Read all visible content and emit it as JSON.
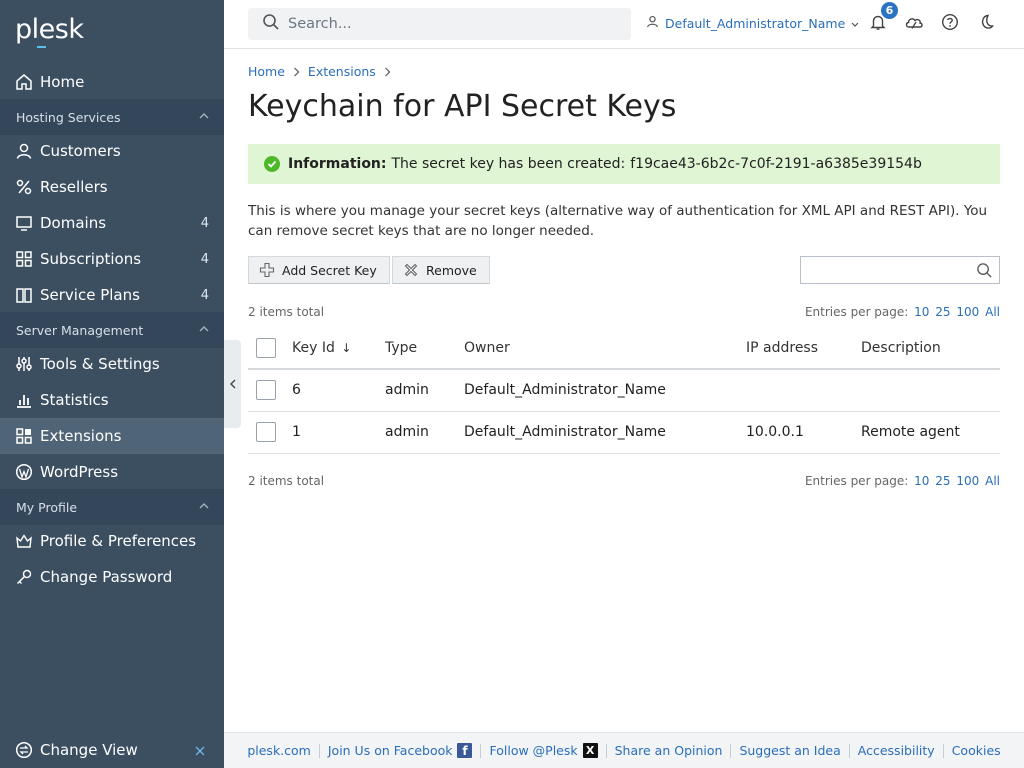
{
  "app": {
    "logo_text": "plesk"
  },
  "sidebar": {
    "home": "Home",
    "sections": {
      "hosting": "Hosting Services",
      "server": "Server Management",
      "profile": "My Profile"
    },
    "items": {
      "customers": "Customers",
      "resellers": "Resellers",
      "domains": {
        "label": "Domains",
        "count": "4"
      },
      "subscriptions": {
        "label": "Subscriptions",
        "count": "4"
      },
      "service_plans": {
        "label": "Service Plans",
        "count": "4"
      },
      "tools": "Tools & Settings",
      "statistics": "Statistics",
      "extensions": "Extensions",
      "wordpress": "WordPress",
      "profile_prefs": "Profile & Preferences",
      "change_password": "Change Password"
    },
    "change_view": "Change View"
  },
  "topbar": {
    "search_placeholder": "Search...",
    "user_name": "Default_Administrator_Name",
    "notification_count": "6"
  },
  "breadcrumb": [
    "Home",
    "Extensions"
  ],
  "page_title": "Keychain for API Secret Keys",
  "info": {
    "label": "Information:",
    "message": "The secret key has been created:",
    "key": "f19cae43-6b2c-7c0f-2191-a6385e39154b"
  },
  "description": "This is where you manage your secret keys (alternative way of authentication for XML API and REST API). You can remove secret keys that are no longer needed.",
  "toolbar": {
    "add_label": "Add Secret Key",
    "remove_label": "Remove"
  },
  "list": {
    "total_text": "2 items total",
    "entries_label": "Entries per page:",
    "page_sizes": [
      "10",
      "25",
      "100",
      "All"
    ],
    "columns": {
      "key_id": "Key Id",
      "sort_indicator": "↓",
      "type": "Type",
      "owner": "Owner",
      "ip": "IP address",
      "description": "Description"
    },
    "rows": [
      {
        "key_id": "6",
        "type": "admin",
        "owner": "Default_Administrator_Name",
        "ip": "",
        "description": ""
      },
      {
        "key_id": "1",
        "type": "admin",
        "owner": "Default_Administrator_Name",
        "ip": "10.0.0.1",
        "description": "Remote agent"
      }
    ]
  },
  "footer": {
    "links": [
      "plesk.com",
      "Join Us on Facebook",
      "Follow @Plesk",
      "Share an Opinion",
      "Suggest an Idea",
      "Accessibility",
      "Cookies"
    ],
    "facebook_glyph": "f",
    "x_glyph": "X"
  },
  "colors": {
    "sidebar_bg": "#3c4f61",
    "section_bg": "#34465a",
    "active_bg": "#4f6477",
    "link": "#2a6ebb",
    "info_bg": "#dff5d3",
    "success": "#4cba28"
  }
}
